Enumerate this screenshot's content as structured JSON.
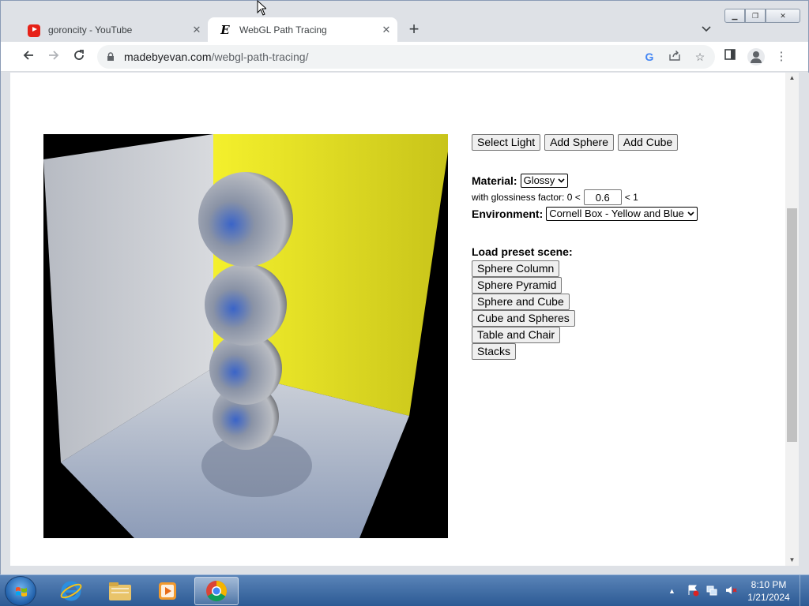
{
  "browser": {
    "tabs": [
      {
        "title": "goroncity - YouTube",
        "favicon": "youtube-icon",
        "active": false
      },
      {
        "title": "WebGL Path Tracing",
        "favicon": "e-icon",
        "active": true
      }
    ],
    "url_host": "madebyevan.com",
    "url_path": "/webgl-path-tracing/",
    "close_glyph": "✕",
    "new_tab_glyph": "+"
  },
  "page": {
    "top_buttons": [
      "Select Light",
      "Add Sphere",
      "Add Cube"
    ],
    "material_label": "Material:",
    "material_value": "Glossy",
    "gloss_prefix": "with glossiness factor: 0 <",
    "gloss_value": "0.6",
    "gloss_suffix": "< 1",
    "environment_label": "Environment:",
    "environment_value": "Cornell Box - Yellow and Blue",
    "preset_title": "Load preset scene:",
    "presets": [
      "Sphere Column",
      "Sphere Pyramid",
      "Sphere and Cube",
      "Cube and Spheres",
      "Table and Chair",
      "Stacks"
    ]
  },
  "taskbar": {
    "time": "8:10 PM",
    "date": "1/21/2024",
    "apps": [
      "internet-explorer-icon",
      "file-explorer-icon",
      "media-player-icon",
      "chrome-icon"
    ]
  },
  "colors": {
    "wall_yellow": "#e8e21a",
    "wall_grey": "#c9ccd2",
    "sphere": "#8a93a6"
  }
}
